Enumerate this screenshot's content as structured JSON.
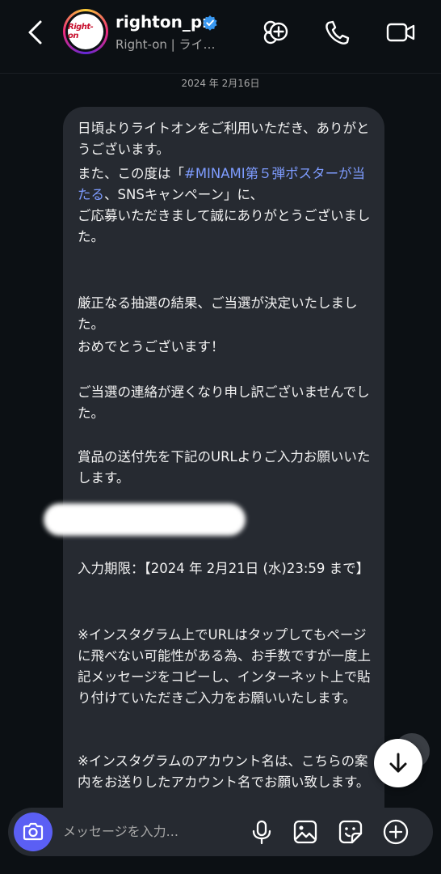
{
  "header": {
    "avatar_logo_text": "Right-on",
    "username": "righton_pr",
    "subtitle": "Right-on  |  ライ…",
    "icons": [
      "back-icon",
      "add-person-icon",
      "phone-icon",
      "video-icon"
    ]
  },
  "date": "2024 年 2月16日",
  "message": {
    "line1": "日頃よりライトオンをご利用いただき、ありがとうございます。",
    "p2_before": "また、この度は「",
    "p2_link": "#MINAMI第５弾ポスターが当たる",
    "p2_after": "、SNSキャンペーン」に、",
    "p2_line3": "ご応募いただきまして誠にありがとうございました。",
    "p3": "厳正なる抽選の結果、ご当選が決定いたしました。",
    "p3b": "おめでとうございます！",
    "p4": "ご当選の連絡が遅くなり申し訳ございませんでした。",
    "p5": "賞品の送付先を下記のURLよりご入力お願いいたします。",
    "p6": "入力期限：【2024 年 2月21日 (水)23:59 まで】",
    "p7": "※インスタグラム上でURLはタップしてもページに飛べない可能性がある為、お手数ですが一度上記メッセージをコピーし、インターネット上で貼り付けていただきご入力をお願いいたします。",
    "p8": "※インスタグラムのアカウント名は、こちらの案内をお送りしたアカウント名でお願い致します。"
  },
  "composer": {
    "placeholder": "メッセージを入力...",
    "icons": [
      "camera-icon",
      "microphone-icon",
      "gallery-icon",
      "sticker-icon",
      "plus-icon"
    ]
  },
  "colors": {
    "background": "#0c1014",
    "bubble": "#262a31",
    "link": "#7e9cff",
    "camera_button": "#5b5ff4",
    "verified": "#3897f0"
  }
}
